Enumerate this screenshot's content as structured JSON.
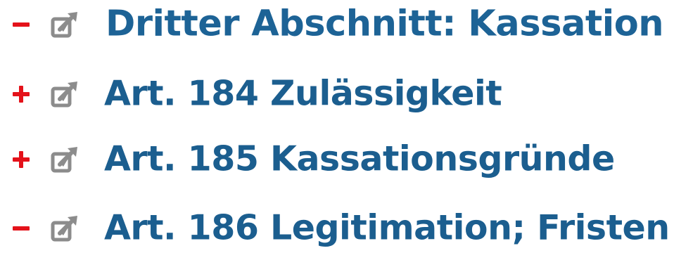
{
  "tree": {
    "items": [
      {
        "toggle": "collapse",
        "toggle_icon": "minus-icon",
        "link_icon": "external-link-icon",
        "label": "Dritter Abschnitt: Kassation"
      },
      {
        "toggle": "expand",
        "toggle_icon": "plus-icon",
        "link_icon": "external-link-icon",
        "label": "Art. 184 Zulässigkeit"
      },
      {
        "toggle": "expand",
        "toggle_icon": "plus-icon",
        "link_icon": "external-link-icon",
        "label": "Art. 185 Kassationsgründe"
      },
      {
        "toggle": "collapse",
        "toggle_icon": "minus-icon",
        "link_icon": "external-link-icon",
        "label": "Art. 186 Legitimation; Fristen"
      }
    ]
  },
  "colors": {
    "toggle": "#e4121a",
    "title": "#1b5e8f",
    "icon": "#8c8c8c"
  }
}
